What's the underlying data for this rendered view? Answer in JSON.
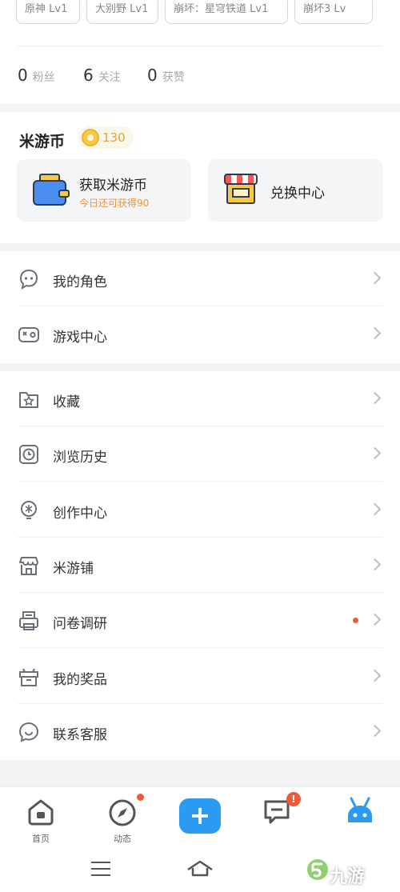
{
  "tags": [
    {
      "text": "原神 Lv1"
    },
    {
      "text": "大别野 Lv1"
    },
    {
      "text": "崩坏：星穹铁道 Lv1"
    },
    {
      "text": "崩坏3 Lv"
    }
  ],
  "stats": [
    {
      "value": "0",
      "label": "粉丝"
    },
    {
      "value": "6",
      "label": "关注"
    },
    {
      "value": "0",
      "label": "获赞"
    }
  ],
  "coin": {
    "title": "米游币",
    "amount": "130",
    "earn_title": "获取米游币",
    "earn_sub": "今日还可获得90",
    "exchange_title": "兑换中心"
  },
  "menu_group_1": [
    {
      "label": "我的角色",
      "icon": "character-icon"
    },
    {
      "label": "游戏中心",
      "icon": "gamepad-icon"
    }
  ],
  "menu_group_2": [
    {
      "label": "收藏",
      "icon": "star-folder-icon"
    },
    {
      "label": "浏览历史",
      "icon": "clock-icon"
    },
    {
      "label": "创作中心",
      "icon": "bulb-icon"
    },
    {
      "label": "米游铺",
      "icon": "store-icon"
    },
    {
      "label": "问卷调研",
      "icon": "printer-icon",
      "has_dot": true
    },
    {
      "label": "我的奖品",
      "icon": "gift-icon"
    },
    {
      "label": "联系客服",
      "icon": "chat-smile-icon"
    }
  ],
  "bottom_nav": [
    {
      "label": "首页",
      "icon": "home-icon"
    },
    {
      "label": "动态",
      "icon": "compass-icon"
    },
    {
      "label": "",
      "icon": "add-icon"
    },
    {
      "label": "",
      "icon": "message-icon",
      "badge": "!"
    },
    {
      "label": "",
      "icon": "mascot-icon"
    }
  ],
  "add_symbol": "+",
  "watermark": "九游",
  "colors": {
    "accent": "#2b9af3",
    "coin": "#e3a43b",
    "alert": "#ef5a3c",
    "sub_orange": "#f0923a"
  }
}
